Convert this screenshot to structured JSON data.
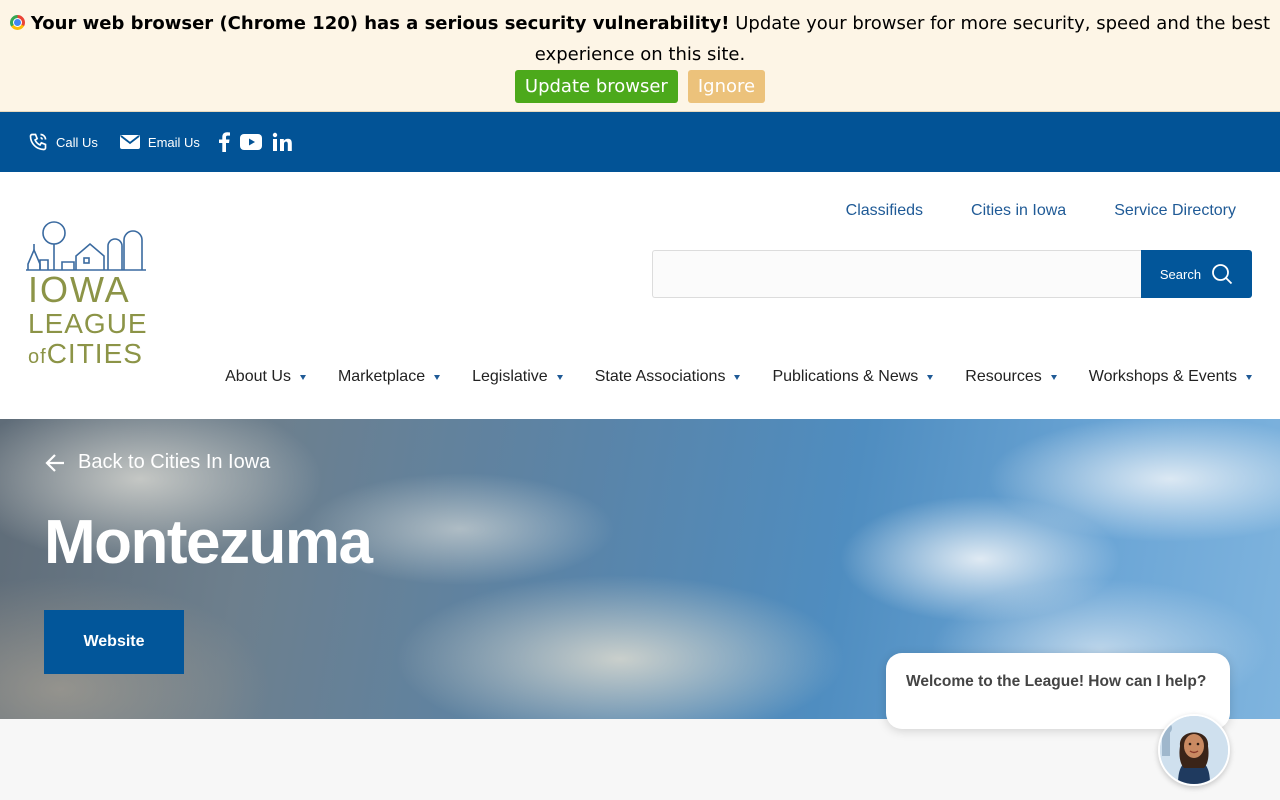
{
  "banner": {
    "bold_text": "Your web browser (Chrome 120) has a serious security vulnerability!",
    "text": "Update your browser for more security, speed and the best experience on this site.",
    "update_label": "Update browser",
    "ignore_label": "Ignore",
    "icon": "chrome-icon"
  },
  "topbar": {
    "call_label": "Call Us",
    "email_label": "Email Us",
    "social": [
      "facebook-icon",
      "youtube-icon",
      "linkedin-icon"
    ]
  },
  "logo": {
    "line1": "IOWA",
    "line2": "LEAGUE",
    "line3_small": "of",
    "line3": "CITIES"
  },
  "utility_nav": [
    "Classifieds",
    "Cities in Iowa",
    "Service Directory"
  ],
  "search": {
    "placeholder": "",
    "button_label": "Search"
  },
  "main_nav": [
    "About Us",
    "Marketplace",
    "Legislative",
    "State Associations",
    "Publications & News",
    "Resources",
    "Workshops & Events"
  ],
  "hero": {
    "back_label": "Back to Cities In Iowa",
    "title": "Montezuma",
    "website_label": "Website"
  },
  "chat": {
    "message": "Welcome to the League! How can I help?"
  },
  "colors": {
    "brand_blue": "#02569a",
    "logo_olive": "#8c9447",
    "banner_bg": "#fdf5e6",
    "update_green": "#4ca91b",
    "ignore_tan": "#ecc27b"
  }
}
